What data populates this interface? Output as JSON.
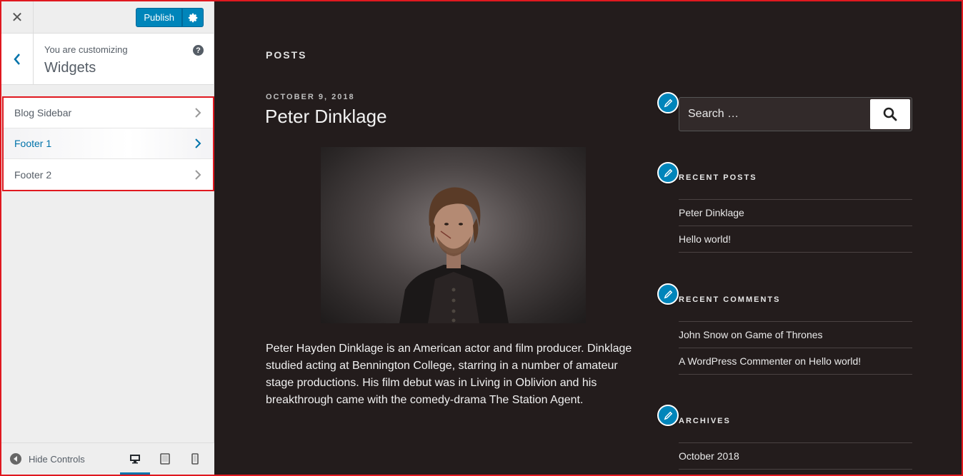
{
  "customizer": {
    "publish_label": "Publish",
    "customizing_label": "You are customizing",
    "customizing_title": "Widgets",
    "sections": [
      {
        "label": "Blog Sidebar",
        "active": false
      },
      {
        "label": "Footer 1",
        "active": true
      },
      {
        "label": "Footer 2",
        "active": false
      }
    ],
    "hide_controls_label": "Hide Controls",
    "devices": [
      "desktop-icon",
      "tablet-icon",
      "mobile-icon"
    ]
  },
  "preview": {
    "posts_heading": "POSTS",
    "post": {
      "date": "OCTOBER 9, 2018",
      "title": "Peter Dinklage",
      "body": "Peter Hayden Dinklage is an American actor and film producer. Dinklage studied acting at Bennington College, starring in a number of amateur stage productions. His film debut was in Living in Oblivion and his breakthrough came with the comedy-drama The Station Agent."
    },
    "search": {
      "placeholder": "Search …"
    },
    "recent_posts": {
      "title": "RECENT POSTS",
      "items": [
        "Peter Dinklage",
        "Hello world!"
      ]
    },
    "recent_comments": {
      "title": "RECENT COMMENTS",
      "items": [
        {
          "author": "John Snow",
          "on": "on",
          "post": "Game of Thrones"
        },
        {
          "author": "A WordPress Commenter",
          "on": "on",
          "post": "Hello world!"
        }
      ]
    },
    "archives": {
      "title": "ARCHIVES",
      "items": [
        "October 2018"
      ]
    }
  },
  "colors": {
    "accent": "#0085ba",
    "highlight_border": "#e0181f",
    "preview_bg": "#231c1c"
  }
}
